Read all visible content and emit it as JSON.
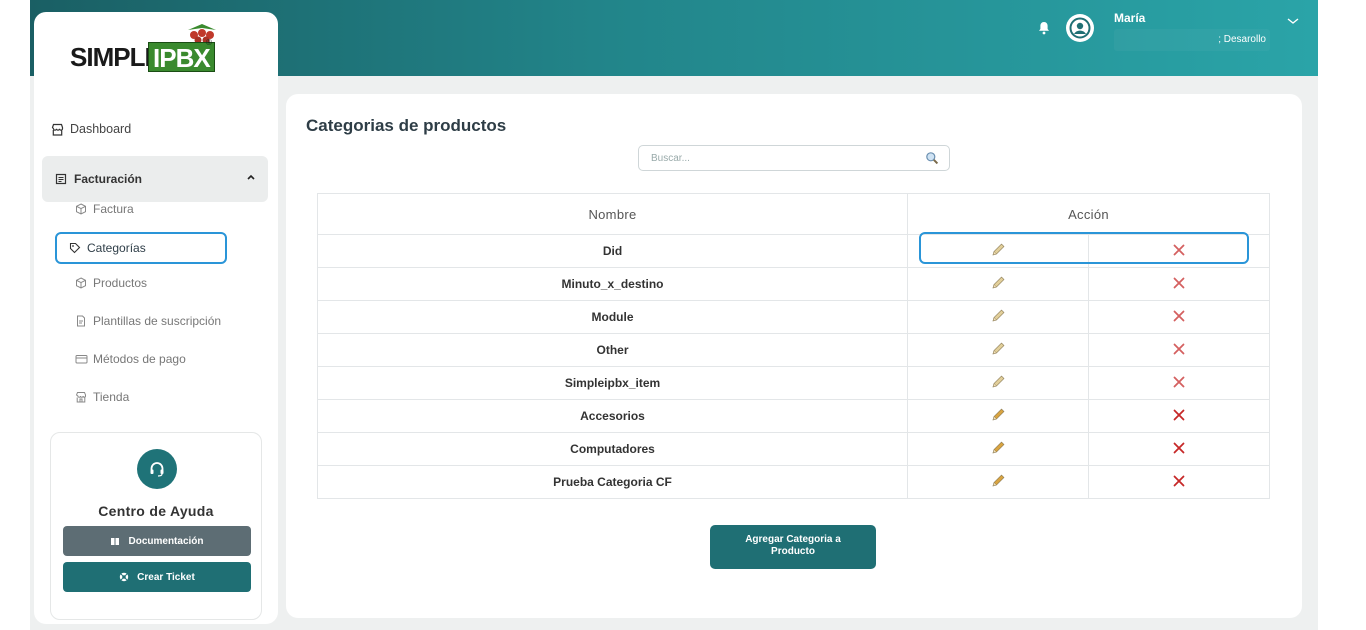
{
  "header": {
    "user_name": "María",
    "user_role": "; Desarollo"
  },
  "logo": {
    "left": "SIMPLE",
    "right": "IPBX",
    "tm": "®"
  },
  "sidebar": {
    "dashboard": "Dashboard",
    "facturacion": "Facturación",
    "sub_items": [
      "Factura",
      "Categorías",
      "Productos",
      "Plantillas de suscripción",
      "Métodos de pago",
      "Tienda"
    ]
  },
  "help": {
    "title": "Centro de Ayuda",
    "doc_button": "Documentación",
    "ticket_button": "Crear Ticket"
  },
  "main": {
    "title": "Categorias de productos",
    "search_placeholder": "Buscar...",
    "columns": {
      "name": "Nombre",
      "action": "Acción"
    },
    "rows": [
      "Did",
      "Minuto_x_destino",
      "Module",
      "Other",
      "Simpleipbx_item",
      "Accesorios",
      "Computadores",
      "Prueba Categoria CF"
    ],
    "add_button_line1": "Agregar Categoria a",
    "add_button_line2": "Producto"
  },
  "colors": {
    "accent": "#1f6f74",
    "highlight": "#2a95d8",
    "delete": "#c62828",
    "edit": "#d9a441"
  }
}
